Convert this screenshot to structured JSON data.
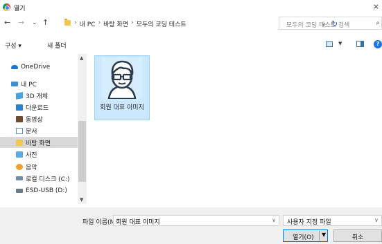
{
  "window": {
    "title": "열기",
    "close_glyph": "×"
  },
  "nav": {
    "back": "←",
    "forward": "→",
    "history": "⌄",
    "up": "↑",
    "breadcrumb": [
      "내 PC",
      "바탕 화면",
      "모두의 코딩 테스트"
    ],
    "separator": "›",
    "search_placeholder": "모두의 코딩 테스트 검색"
  },
  "toolbar": {
    "organize": "구성 ▾",
    "new_folder": "새 폴더"
  },
  "tree": [
    {
      "label": "OneDrive",
      "icon": "cloud-icon",
      "selected": false
    },
    {
      "label": "내 PC",
      "icon": "pc-icon",
      "selected": false
    },
    {
      "label": "3D 개체",
      "icon": "cube-icon",
      "selected": false
    },
    {
      "label": "다운로드",
      "icon": "download-icon",
      "selected": false
    },
    {
      "label": "동영상",
      "icon": "video-icon",
      "selected": false
    },
    {
      "label": "문서",
      "icon": "document-icon",
      "selected": false
    },
    {
      "label": "바탕 화면",
      "icon": "folder-icon",
      "selected": true
    },
    {
      "label": "사진",
      "icon": "photo-icon",
      "selected": false
    },
    {
      "label": "음악",
      "icon": "music-icon",
      "selected": false
    },
    {
      "label": "로컬 디스크 (C:)",
      "icon": "disk-icon",
      "selected": false
    },
    {
      "label": "ESD-USB (D:)",
      "icon": "usb-icon",
      "selected": false
    }
  ],
  "files": [
    {
      "name": "회원 대표 이미지",
      "icon": "avatar-glasses-icon",
      "selected": true
    }
  ],
  "footer": {
    "filename_label": "파일 이름(N):",
    "filename_value": "회원 대표 이미지",
    "filetype_value": "사용자 지정 파일",
    "open_label": "열기(O)",
    "cancel_label": "취소"
  },
  "colors": {
    "selection_fill": "#cce8ff",
    "selection_border": "#99d1ff",
    "accent": "#0078d7"
  }
}
